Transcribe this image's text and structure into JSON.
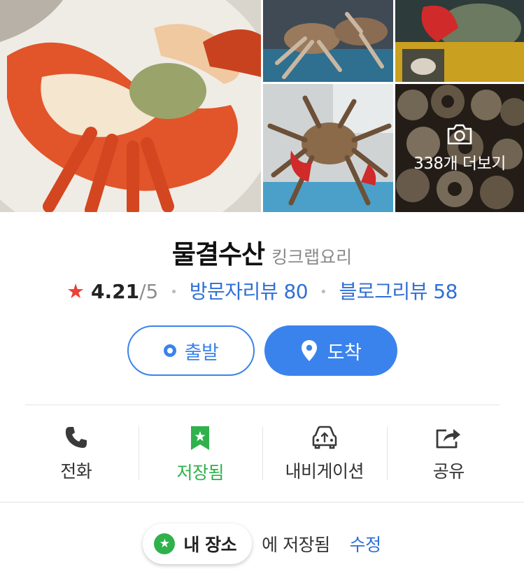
{
  "place": {
    "name": "물결수산",
    "category": "킹크랩요리",
    "rating": "4.21",
    "rating_max": "/5",
    "visitor_reviews": "방문자리뷰 80",
    "blog_reviews": "블로그리뷰 58"
  },
  "gallery": {
    "more_label": "338개 더보기",
    "photos": [
      "lobster-platter",
      "king-crabs-in-tank",
      "crab-held-red-gloves",
      "king-crab-held-up",
      "sea-snails"
    ]
  },
  "route": {
    "depart_label": "출발",
    "arrive_label": "도착"
  },
  "actions": {
    "call": "전화",
    "saved": "저장됨",
    "navigation": "내비게이션",
    "share": "공유"
  },
  "saved_row": {
    "chip_label": "내 장소",
    "suffix": "에 저장됨",
    "edit": "수정"
  },
  "colors": {
    "accent_blue": "#3b83ec",
    "link_blue": "#2f6fd6",
    "saved_green": "#2fb14b",
    "star_red": "#e8423b"
  }
}
